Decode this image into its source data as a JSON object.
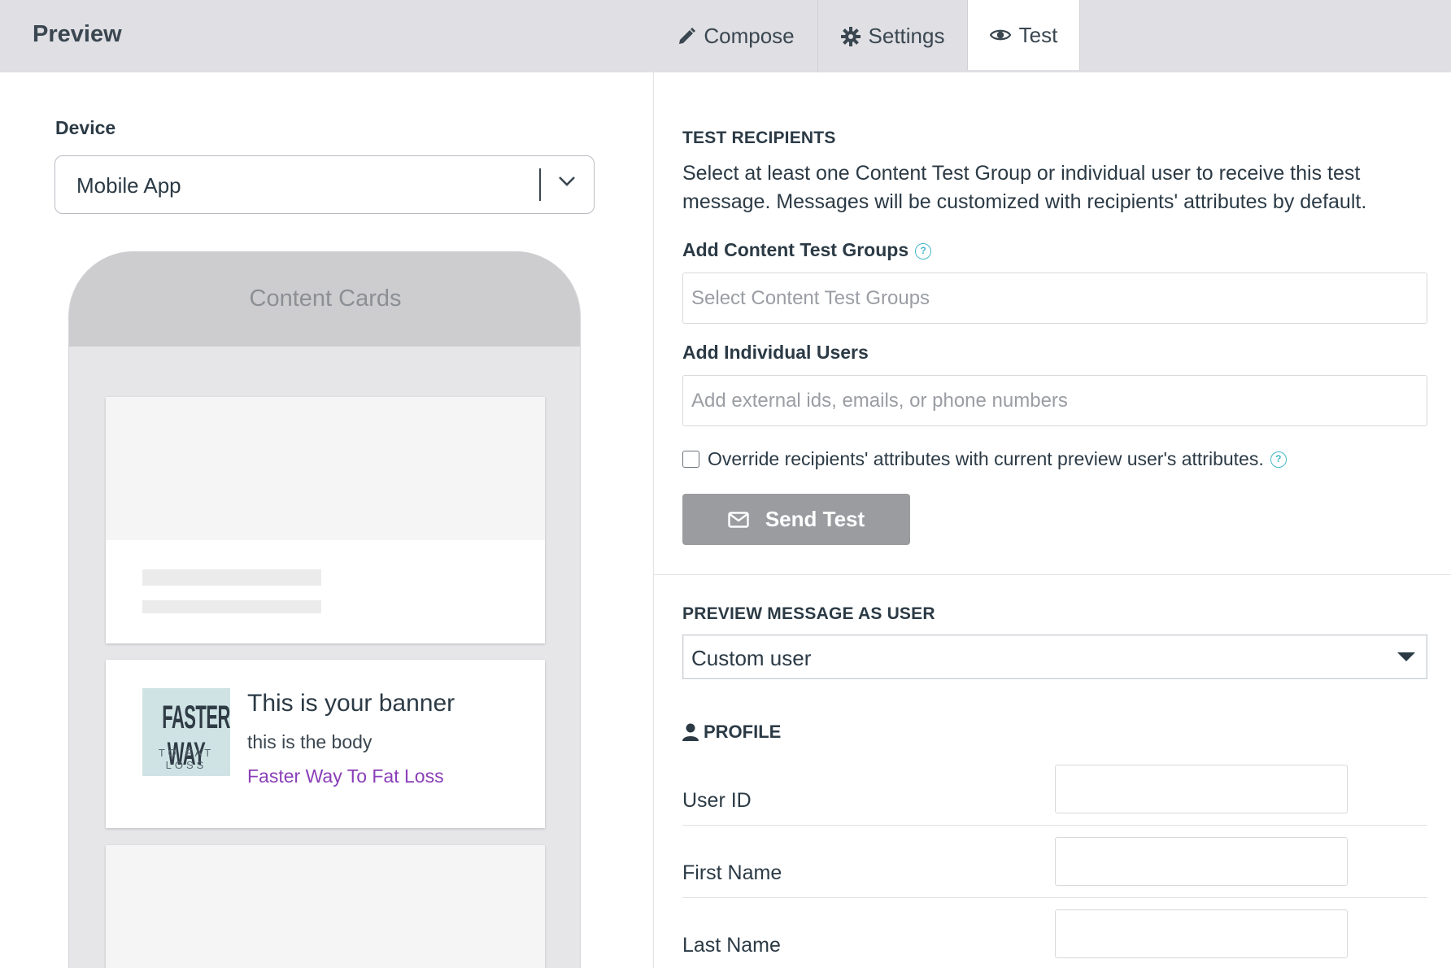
{
  "header": {
    "title": "Preview",
    "tabs": [
      {
        "label": "Compose",
        "icon": "pencil-icon"
      },
      {
        "label": "Settings",
        "icon": "gear-icon"
      },
      {
        "label": "Test",
        "icon": "eye-icon",
        "active": true
      }
    ]
  },
  "left": {
    "device_label": "Device",
    "device_value": "Mobile App",
    "phone_title": "Content Cards",
    "banner_card": {
      "logo_text": "FASTER WAY",
      "logo_subtext": "TO FAT LOSS",
      "title": "This is your banner",
      "body": "this is the body",
      "link": "Faster Way To Fat Loss"
    }
  },
  "right": {
    "test_recipients": {
      "title": "TEST RECIPIENTS",
      "description": "Select at least one Content Test Group or individual user to receive this test message. Messages will be customized with recipients' attributes by default.",
      "groups_label": "Add Content Test Groups",
      "groups_placeholder": "Select Content Test Groups",
      "users_label": "Add Individual Users",
      "users_placeholder": "Add external ids, emails, or phone numbers",
      "override_label": "Override recipients' attributes with current preview user's attributes.",
      "send_label": "Send Test",
      "help_glyph": "?"
    },
    "preview_user": {
      "title": "PREVIEW MESSAGE AS USER",
      "selected": "Custom user",
      "profile_title": "PROFILE",
      "fields": [
        {
          "label": "User ID"
        },
        {
          "label": "First Name"
        },
        {
          "label": "Last Name"
        }
      ]
    }
  },
  "colors": {
    "topbar": "#dfdfe4",
    "link_purple": "#8a3fb8",
    "help_teal": "#43b7c6",
    "send_button": "#9a9ca0"
  }
}
